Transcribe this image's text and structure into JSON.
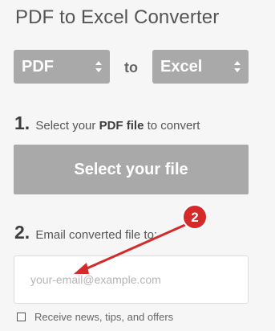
{
  "page": {
    "title": "PDF to Excel Converter"
  },
  "converter": {
    "from_format": "PDF",
    "connector": "to",
    "to_format": "Excel"
  },
  "step1": {
    "number": "1.",
    "text_before": "Select your",
    "text_bold": "PDF file",
    "text_after": "to convert",
    "button_label": "Select your file"
  },
  "step2": {
    "number": "2.",
    "text": "Email converted file to:",
    "email_placeholder": "your-email@example.com",
    "email_value": ""
  },
  "newsletter": {
    "checked": false,
    "label": "Receive news, tips, and offers"
  },
  "annotation": {
    "badge_number": "2",
    "color": "#d42a2a"
  },
  "colors": {
    "button_gray": "#a9a9a9",
    "background": "#f6f6f6"
  }
}
